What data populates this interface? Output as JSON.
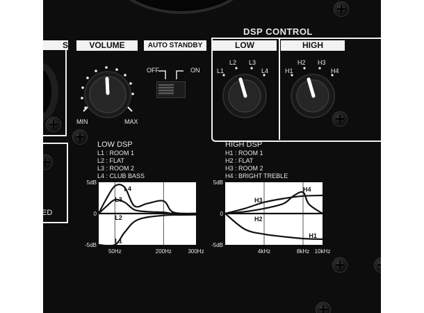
{
  "sections": {
    "volume": "VOLUME",
    "auto_standby": "AUTO STANDBY",
    "dsp_control": "DSP CONTROL",
    "low": "LOW",
    "high": "HIGH",
    "left_partial": "S"
  },
  "volume_knob": {
    "min_label": "MIN",
    "max_label": "MAX"
  },
  "standby_switch": {
    "off_label": "OFF",
    "on_label": "ON",
    "state": "off"
  },
  "low_knob": {
    "positions": [
      "L1",
      "L2",
      "L3",
      "L4"
    ],
    "selected": "L2"
  },
  "high_knob": {
    "positions": [
      "H1",
      "H2",
      "H3",
      "H4"
    ],
    "selected": "H2"
  },
  "left_partial_text": "ED",
  "low_dsp": {
    "title": "LOW DSP",
    "legend": [
      "L1 : ROOM 1",
      "L2 : FLAT",
      "L3 : ROOM 2",
      "L4 : CLUB BASS"
    ]
  },
  "high_dsp": {
    "title": "HIGH DSP",
    "legend": [
      "H1 : ROOM 1",
      "H2 : FLAT",
      "H3 : ROOM 2",
      "H4 : BRIGHT TREBLE"
    ]
  },
  "chart_data": [
    {
      "type": "line",
      "title": "LOW DSP",
      "x_ticks": [
        "50Hz",
        "200Hz",
        "300Hz"
      ],
      "y_ticks": [
        "5dB",
        "0",
        "-5dB"
      ],
      "ylim": [
        -5,
        5
      ],
      "series": [
        {
          "name": "L1",
          "x": [
            0,
            50,
            80,
            120,
            200,
            300
          ],
          "y": [
            -5,
            -5,
            -3,
            -1,
            -0.3,
            -0.2
          ]
        },
        {
          "name": "L2",
          "x": [
            0,
            50,
            120,
            200,
            300
          ],
          "y": [
            0,
            0,
            0,
            0,
            0
          ]
        },
        {
          "name": "L3",
          "x": [
            0,
            25,
            50,
            80,
            110,
            150,
            200,
            230,
            300
          ],
          "y": [
            0,
            1.2,
            2.2,
            1.8,
            0.6,
            0.3,
            0.2,
            0,
            0
          ]
        },
        {
          "name": "L4",
          "x": [
            0,
            20,
            50,
            80,
            110,
            150,
            200,
            230,
            300
          ],
          "y": [
            0,
            2,
            4.4,
            4.2,
            1.2,
            1.6,
            2.0,
            0.2,
            0
          ]
        }
      ]
    },
    {
      "type": "line",
      "title": "HIGH DSP",
      "x_ticks": [
        "4kHz",
        "8kHz",
        "10kHz"
      ],
      "y_ticks": [
        "5dB",
        "0",
        "-5dB"
      ],
      "ylim": [
        -5,
        5
      ],
      "series": [
        {
          "name": "H1",
          "x": [
            0,
            2,
            4,
            6,
            8,
            10
          ],
          "y": [
            0,
            -2.5,
            -3.3,
            -3.7,
            -4,
            -4.1
          ]
        },
        {
          "name": "H2",
          "x": [
            0,
            4,
            8,
            10
          ],
          "y": [
            0,
            0,
            0,
            0
          ]
        },
        {
          "name": "H3",
          "x": [
            0,
            2,
            4,
            6,
            8,
            10
          ],
          "y": [
            0,
            0.8,
            1.8,
            2.4,
            2.8,
            2.9
          ]
        },
        {
          "name": "H4",
          "x": [
            0,
            2,
            4,
            6,
            7,
            8,
            8.6,
            10
          ],
          "y": [
            0,
            0.3,
            0.8,
            1.6,
            2.8,
            3.4,
            1.5,
            0
          ]
        }
      ]
    }
  ]
}
